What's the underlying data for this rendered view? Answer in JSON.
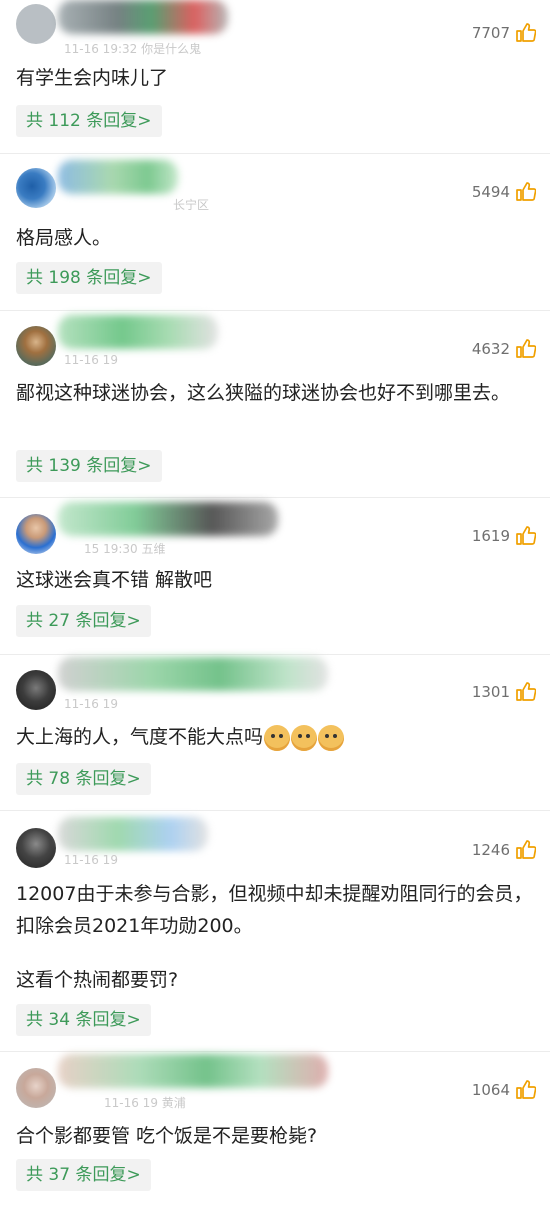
{
  "colors": {
    "reply_green": "#3d9a59",
    "reply_bg": "#f2f2f2",
    "like_icon": "#f0a000",
    "text": "#222222",
    "meta": "#c9c9c9"
  },
  "comments": [
    {
      "meta": "11-16 19:32 你是什么鬼",
      "likes": "7707",
      "text": "有学生会内味儿了",
      "reply": "共 112 条回复>"
    },
    {
      "meta": "长宁区",
      "likes": "5494",
      "text": "格局感人。",
      "reply": "共 198 条回复>"
    },
    {
      "meta": "11-16 19",
      "likes": "4632",
      "text": "鄙视这种球迷协会，这么狭隘的球迷协会也好不到哪里去。",
      "reply": "共 139 条回复>"
    },
    {
      "meta": "15 19:30 五维",
      "likes": "1619",
      "text": "这球迷会真不错 解散吧",
      "reply": "共 27 条回复>"
    },
    {
      "meta": "11-16 19",
      "likes": "1301",
      "text": "大上海的人，气度不能大点吗",
      "emoji": "doge-emoji",
      "reply": "共 78 条回复>"
    },
    {
      "meta": "11-16 19",
      "likes": "1246",
      "text": "12007由于未参与合影，但视频中却未提醒劝阻同行的会员，扣除会员2021年功勋200。",
      "text2": "这看个热闹都要罚?",
      "reply": "共 34 条回复>"
    },
    {
      "meta": "11-16 19 黄浦",
      "likes": "1064",
      "text": "合个影都要管 吃个饭是不是要枪毙?",
      "reply": "共 37 条回复>"
    }
  ],
  "icons": {
    "like": "thumbs-up-icon",
    "avatar": "avatar"
  }
}
